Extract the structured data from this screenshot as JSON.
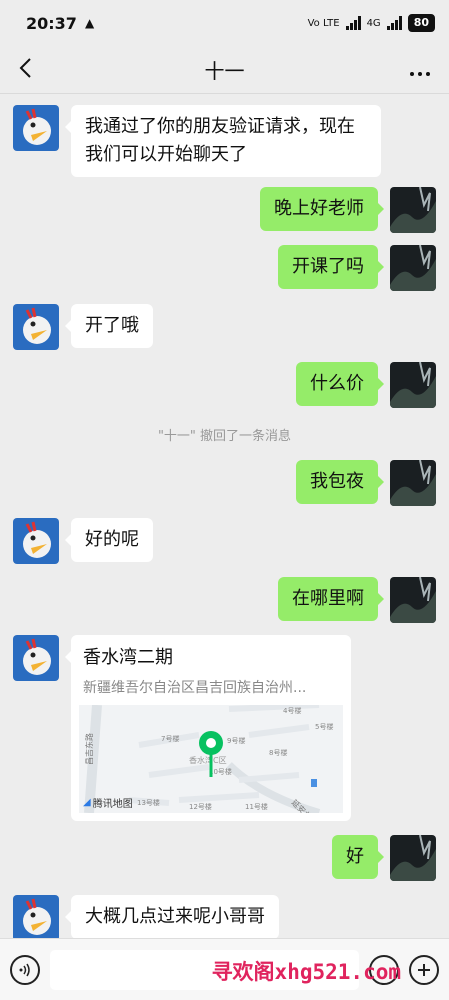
{
  "status_bar": {
    "time": "20:37",
    "network_label": "Vo LTE",
    "network_label2": "4G",
    "battery": "80"
  },
  "header": {
    "title": "十一",
    "back_icon": "chevron-left-icon",
    "more_icon": "more-dots-icon"
  },
  "messages": [
    {
      "side": "left",
      "text": "我通过了你的朋友验证请求，现在我们可以开始聊天了"
    },
    {
      "side": "right",
      "text": "晚上好老师"
    },
    {
      "side": "right",
      "text": "开课了吗"
    },
    {
      "side": "left",
      "text": "开了哦"
    },
    {
      "side": "right",
      "text": "什么价"
    },
    {
      "side": "right",
      "text": "我包夜"
    },
    {
      "side": "left",
      "text": "好的呢"
    },
    {
      "side": "right",
      "text": "在哪里啊"
    },
    {
      "side": "right",
      "text": "好"
    },
    {
      "side": "left",
      "text": "大概几点过来呢小哥哥"
    }
  ],
  "system_message": "\"十一\" 撤回了一条消息",
  "location": {
    "title": "香水湾二期",
    "address": "新疆维吾尔自治区昌吉回族自治州...",
    "map_brand": "腾讯地图",
    "map_labels": {
      "road1": "昌吉东路",
      "road2": "延安北路",
      "b4": "4号楼",
      "b5": "5号楼",
      "b7": "7号楼",
      "b9": "9号楼",
      "b8": "8号楼",
      "b10": "10号楼",
      "b13": "13号楼",
      "b12": "12号楼",
      "b11": "11号楼",
      "district": "香水湾C区"
    }
  },
  "input_bar": {
    "voice_icon": "voice-icon",
    "emoji_icon": "emoji-icon",
    "plus_icon": "plus-icon"
  },
  "watermark": "寻欢阁xhg521.com",
  "colors": {
    "background": "#ededed",
    "my_bubble": "#95ec69",
    "their_bubble": "#ffffff",
    "map_pin": "#07c160",
    "watermark": "#e0245e"
  }
}
